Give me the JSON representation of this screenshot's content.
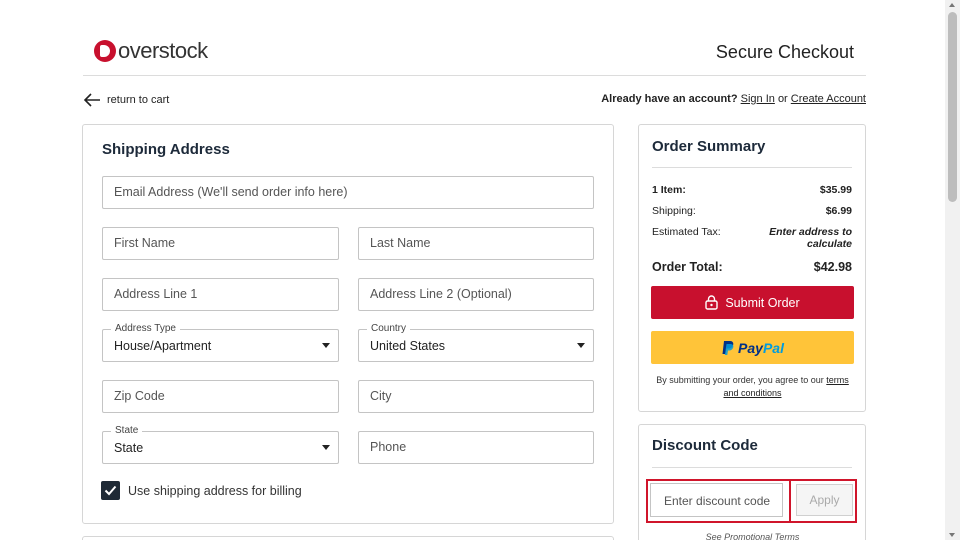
{
  "header": {
    "logo_text": "overstock",
    "page_title": "Secure Checkout"
  },
  "nav": {
    "back_label": "return to cart",
    "account_prompt": "Already have an account?",
    "sign_in": "Sign In",
    "or": "or",
    "create_account": "Create Account"
  },
  "shipping": {
    "title": "Shipping Address",
    "email_placeholder": "Email Address (We'll send order info here)",
    "first_name_placeholder": "First Name",
    "last_name_placeholder": "Last Name",
    "address1_placeholder": "Address Line 1",
    "address2_placeholder": "Address Line 2 (Optional)",
    "address_type_label": "Address Type",
    "address_type_value": "House/Apartment",
    "country_label": "Country",
    "country_value": "United States",
    "zip_placeholder": "Zip Code",
    "city_placeholder": "City",
    "state_label": "State",
    "state_value": "State",
    "phone_placeholder": "Phone",
    "billing_checkbox_label": "Use shipping address for billing",
    "billing_checked": true
  },
  "summary": {
    "title": "Order Summary",
    "items_label": "1 Item:",
    "items_value": "$35.99",
    "shipping_label": "Shipping:",
    "shipping_value": "$6.99",
    "tax_label": "Estimated Tax:",
    "tax_value_line1": "Enter address to",
    "tax_value_line2": "calculate",
    "total_label": "Order Total:",
    "total_value": "$42.98",
    "submit_label": "Submit Order",
    "paypal_pay": "Pay",
    "paypal_pal": "Pal",
    "terms_prefix": "By submitting your order, you agree to our",
    "terms_link": "terms and conditions"
  },
  "discount": {
    "title": "Discount Code",
    "input_placeholder": "Enter discount code",
    "apply_label": "Apply",
    "promo_terms": "See Promotional Terms"
  },
  "colors": {
    "brand_red": "#c8102e",
    "paypal_yellow": "#ffc439",
    "paypal_dark_blue": "#003087",
    "paypal_light_blue": "#009cde",
    "highlight_red": "#d0152b"
  },
  "icons": {
    "back": "arrow-left-icon",
    "lock": "lock-icon",
    "check": "checkmark-icon",
    "caret": "caret-down-icon"
  }
}
